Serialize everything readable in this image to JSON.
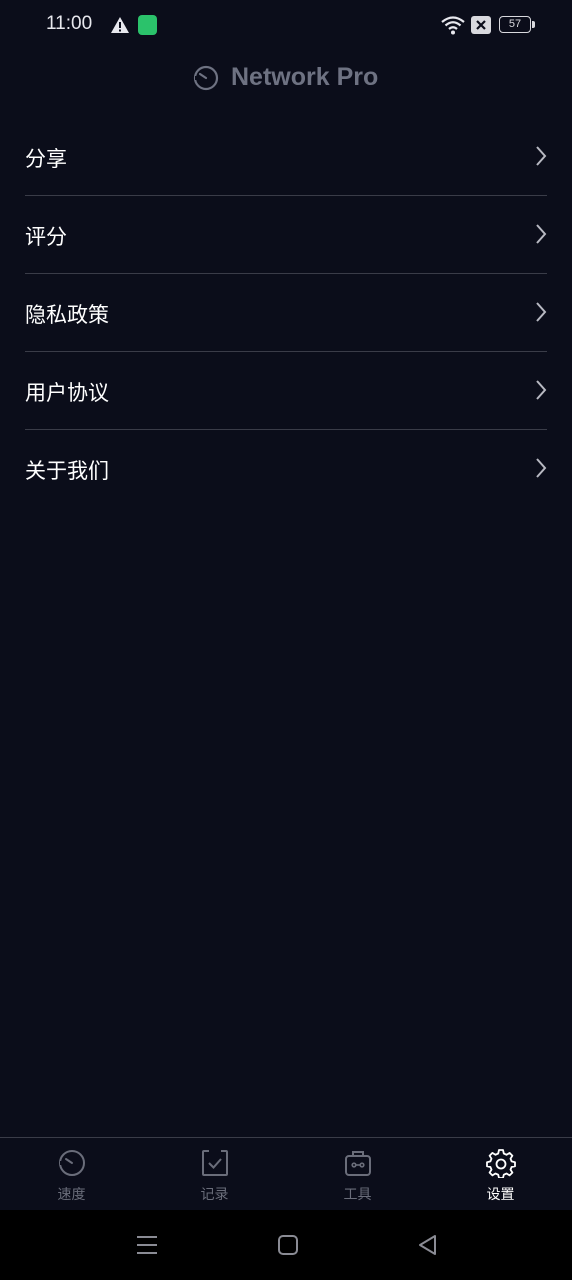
{
  "status_bar": {
    "time": "11:00",
    "battery": "57"
  },
  "header": {
    "title": "Network Pro"
  },
  "menu": {
    "items": [
      {
        "label": "分享"
      },
      {
        "label": "评分"
      },
      {
        "label": "隐私政策"
      },
      {
        "label": "用户协议"
      },
      {
        "label": "关于我们"
      }
    ]
  },
  "bottom_nav": {
    "tabs": [
      {
        "label": "速度",
        "icon": "speedometer-icon",
        "active": false
      },
      {
        "label": "记录",
        "icon": "checklist-icon",
        "active": false
      },
      {
        "label": "工具",
        "icon": "toolbox-icon",
        "active": false
      },
      {
        "label": "设置",
        "icon": "gear-icon",
        "active": true
      }
    ]
  },
  "colors": {
    "background": "#0b0d1a",
    "divider": "#3a3c48",
    "inactive": "#6a6d7a",
    "active": "#ffffff"
  }
}
